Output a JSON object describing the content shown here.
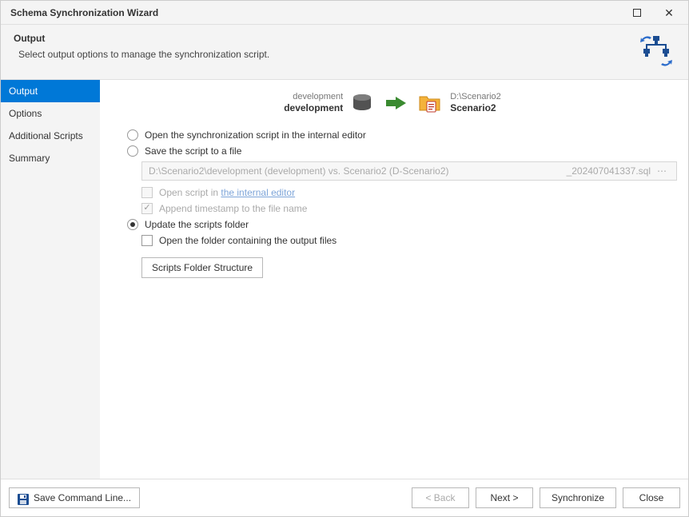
{
  "window": {
    "title": "Schema Synchronization Wizard"
  },
  "header": {
    "title": "Output",
    "subtitle": "Select output options to manage the synchronization script."
  },
  "sidebar": {
    "items": [
      {
        "label": "Output",
        "active": true
      },
      {
        "label": "Options"
      },
      {
        "label": "Additional Scripts"
      },
      {
        "label": "Summary"
      }
    ]
  },
  "conn": {
    "source_top": "development",
    "source_bot": "development",
    "target_top": "D:\\Scenario2",
    "target_bot": "Scenario2"
  },
  "options": {
    "open_internal": "Open the synchronization script in the internal editor",
    "save_to_file": "Save the script to a file",
    "file_path": "D:\\Scenario2\\development (development) vs. Scenario2 (D-Scenario2)",
    "file_suffix": "_202407041337.sql",
    "open_in_prefix": "Open script in ",
    "open_in_link": "the internal editor",
    "append_ts": "Append timestamp to the file name",
    "update_folder": "Update the scripts folder",
    "open_folder": "Open the folder containing the output files",
    "scripts_btn": "Scripts Folder Structure"
  },
  "footer": {
    "save_cmd": "Save Command Line...",
    "back": "< Back",
    "next": "Next >",
    "sync": "Synchronize",
    "close": "Close"
  }
}
